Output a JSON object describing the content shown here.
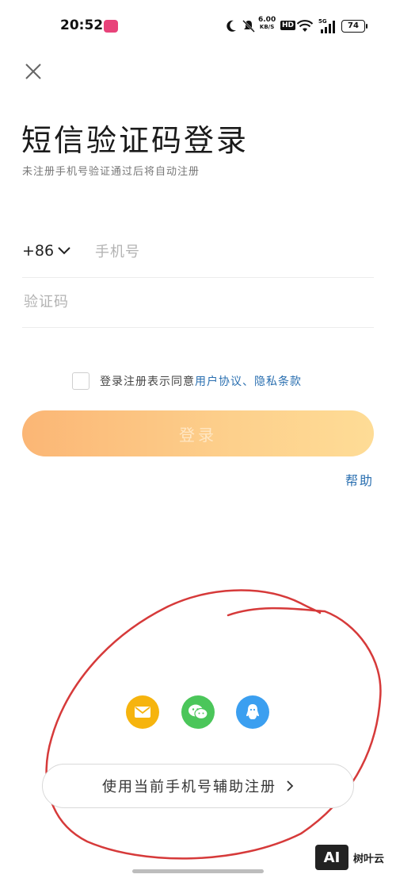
{
  "status_bar": {
    "time": "20:52",
    "net_speed_value": "6.00",
    "net_speed_unit": "KB/S",
    "hd": "HD",
    "network": "5G",
    "battery": "74"
  },
  "login": {
    "title": "短信验证码登录",
    "subtitle": "未注册手机号验证通过后将自动注册",
    "country_code": "+86",
    "phone_placeholder": "手机号",
    "code_placeholder": "验证码",
    "agreement_prefix": "登录注册表示同意",
    "user_agreement": "用户协议",
    "separator": "、",
    "privacy_policy": "隐私条款",
    "login_button": "登录",
    "help": "帮助"
  },
  "social": {
    "icons": [
      "mail-icon",
      "wechat-icon",
      "qq-icon"
    ],
    "colors": {
      "mail": "#f6b40e",
      "wechat": "#4bc65a",
      "qq": "#3b9ff0"
    }
  },
  "assist_register": {
    "label": "使用当前手机号辅助注册",
    "arrow": "›"
  },
  "watermark": {
    "logo": "AI",
    "text": "树叶云"
  },
  "colors": {
    "accent_link": "#2a6fb0",
    "button_gradient_start": "#fbb675",
    "button_gradient_end": "#fedc96",
    "annotation_red": "#d63a3a"
  }
}
